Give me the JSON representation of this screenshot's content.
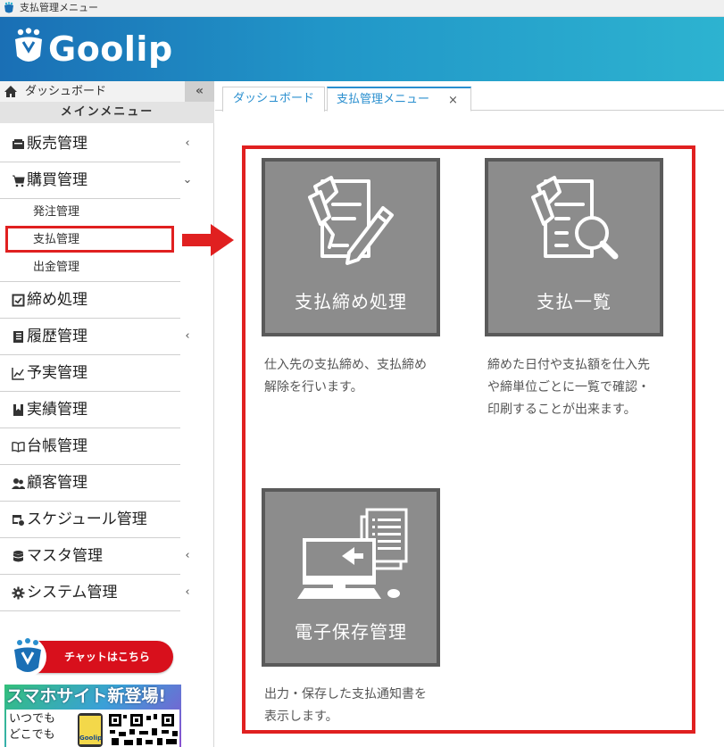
{
  "window": {
    "title": "支払管理メニュー"
  },
  "header": {
    "brand": "Goolip"
  },
  "sidebar": {
    "dashboard_label": "ダッシュボード",
    "collapse_label": "«",
    "main_menu_label": "メインメニュー",
    "items": [
      {
        "label": "販売管理",
        "icon": "register-icon",
        "chevron": "‹"
      },
      {
        "label": "購買管理",
        "icon": "cart-icon",
        "chevron": "⌄"
      },
      {
        "label": "締め処理",
        "icon": "checkbox-icon",
        "chevron": ""
      },
      {
        "label": "履歴管理",
        "icon": "book-icon",
        "chevron": "‹"
      },
      {
        "label": "予実管理",
        "icon": "line-chart-icon",
        "chevron": ""
      },
      {
        "label": "実績管理",
        "icon": "bookmark-icon",
        "chevron": ""
      },
      {
        "label": "台帳管理",
        "icon": "open-book-icon",
        "chevron": ""
      },
      {
        "label": "顧客管理",
        "icon": "users-icon",
        "chevron": ""
      },
      {
        "label": "スケジュール管理",
        "icon": "calendar-clock-icon",
        "chevron": ""
      },
      {
        "label": "マスタ管理",
        "icon": "database-icon",
        "chevron": "‹"
      },
      {
        "label": "システム管理",
        "icon": "gear-icon",
        "chevron": "‹"
      }
    ],
    "sub_items": [
      "発注管理",
      "支払管理",
      "出金管理"
    ],
    "chat_banner": "チャットはこちら",
    "smartphone_banner": {
      "title": "スマホサイト新登場!",
      "line1": "いつでも",
      "line2": "どこでも",
      "phone_label": "Goolip"
    }
  },
  "tabs": [
    {
      "label": "ダッシュボード",
      "active": false
    },
    {
      "label": "支払管理メニュー",
      "active": true,
      "close": "×"
    }
  ],
  "tiles": [
    {
      "label": "支払締め処理",
      "icon": "payment-close-icon",
      "description_lines": [
        "仕入先の支払締め、支払締め",
        "解除を行います。"
      ]
    },
    {
      "label": "支払一覧",
      "icon": "payment-search-icon",
      "description_lines": [
        "締めた日付や支払額を仕入先",
        "や締単位ごとに一覧で確認・",
        "印刷することが出来ます。"
      ]
    },
    {
      "label": "電子保存管理",
      "icon": "computer-document-icon",
      "description_lines": [
        "出力・保存した支払通知書を",
        "表示します。"
      ]
    }
  ],
  "colors": {
    "header_gradient_start": "#1a6fb5",
    "header_gradient_end": "#2db3d0",
    "highlight": "#e02020",
    "tile_background": "#8c8c8c",
    "tile_border": "#5a5a5a",
    "tab_accent": "#2a8fcf"
  }
}
